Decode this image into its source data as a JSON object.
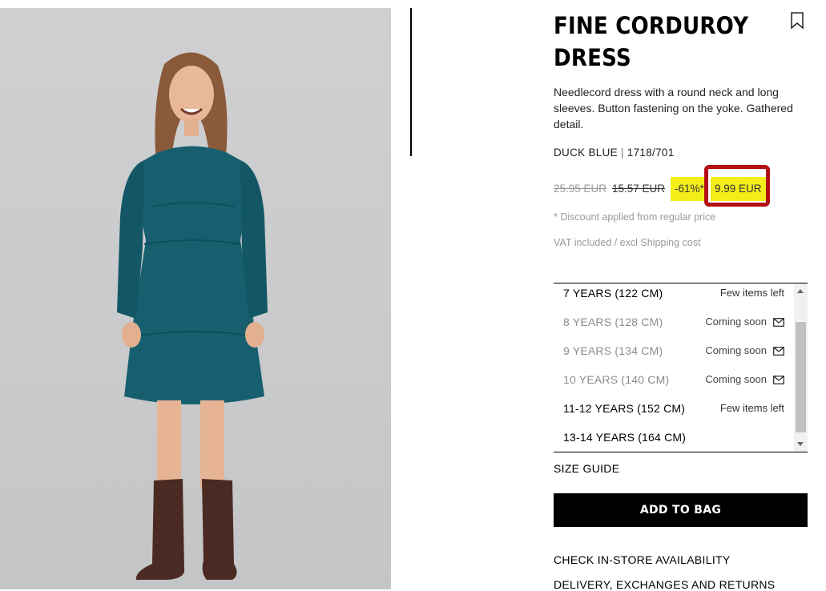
{
  "product": {
    "title_line1": "FINE CORDUROY",
    "title_line2": "DRESS",
    "bookmark_icon": "bookmark-icon",
    "description": "Needlecord dress with a round neck and long sleeves. Button fastening on the yoke. Gathered detail.",
    "color": "DUCK BLUE",
    "separator": "|",
    "reference": "1718/701"
  },
  "price": {
    "regular": "25.95 EUR",
    "previous": "15.57 EUR",
    "discount": "-61%*",
    "final": "9.99 EUR",
    "highlight_color": "#f3ee19",
    "annotation_box_color": "#b40f14",
    "discount_note": "* Discount applied from regular price",
    "vat_note": "VAT included / excl Shipping cost"
  },
  "sizes": [
    {
      "label": "7 YEARS (122 CM)",
      "status": "Few items left",
      "available": true
    },
    {
      "label": "8 YEARS (128 CM)",
      "status": "Coming soon",
      "available": false,
      "icon": "mail-icon"
    },
    {
      "label": "9 YEARS (134 CM)",
      "status": "Coming soon",
      "available": false,
      "icon": "mail-icon"
    },
    {
      "label": "10 YEARS (140 CM)",
      "status": "Coming soon",
      "available": false,
      "icon": "mail-icon"
    },
    {
      "label": "11-12 YEARS (152 CM)",
      "status": "Few items left",
      "available": true
    },
    {
      "label": "13-14 YEARS (164 CM)",
      "status": "",
      "available": true
    }
  ],
  "actions": {
    "size_guide": "SIZE GUIDE",
    "add_to_bag": "ADD TO BAG",
    "check_store": "CHECK IN-STORE AVAILABILITY",
    "delivery": "DELIVERY, EXCHANGES AND RETURNS"
  }
}
